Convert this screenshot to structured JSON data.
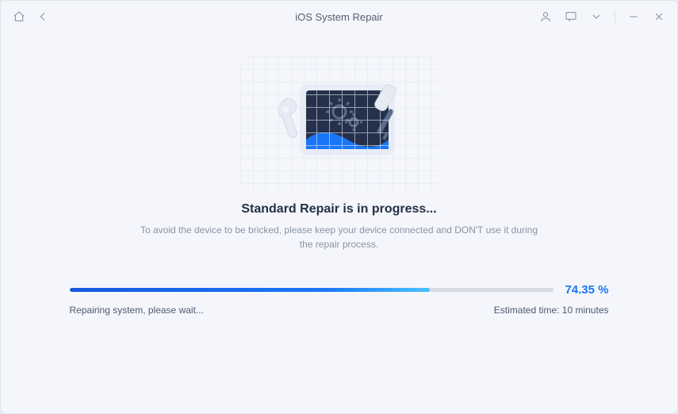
{
  "titlebar": {
    "title": "iOS System Repair"
  },
  "main": {
    "heading": "Standard Repair is in progress...",
    "subtext": "To avoid the device to be bricked, please keep your device connected and DON'T use it during the repair process."
  },
  "progress": {
    "percent_label": "74.35 %",
    "percent_value": 74.35,
    "status_text": "Repairing system, please wait...",
    "eta_text": "Estimated time: 10 minutes"
  }
}
